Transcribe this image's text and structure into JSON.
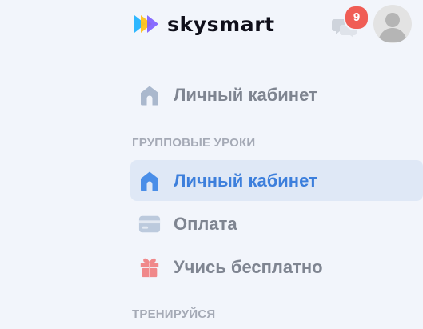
{
  "header": {
    "brand": "skysmart",
    "notifications_count": "9"
  },
  "nav": {
    "top_item": {
      "label": "Личный кабинет",
      "icon": "home-icon"
    },
    "sections": [
      {
        "title": "ГРУППОВЫЕ УРОКИ",
        "items": [
          {
            "label": "Личный кабинет",
            "icon": "home-icon",
            "active": true
          },
          {
            "label": "Оплата",
            "icon": "credit-card-icon",
            "active": false
          },
          {
            "label": "Учись бесплатно",
            "icon": "gift-icon",
            "active": false
          }
        ]
      },
      {
        "title": "ТРЕНИРУЙСЯ",
        "items": []
      }
    ]
  },
  "colors": {
    "background": "#f2f5fb",
    "active_bg": "#dfe8f6",
    "active_text": "#3d7fdc",
    "text": "#7f8591",
    "section_title": "#a5aab6",
    "badge": "#f05d55"
  }
}
